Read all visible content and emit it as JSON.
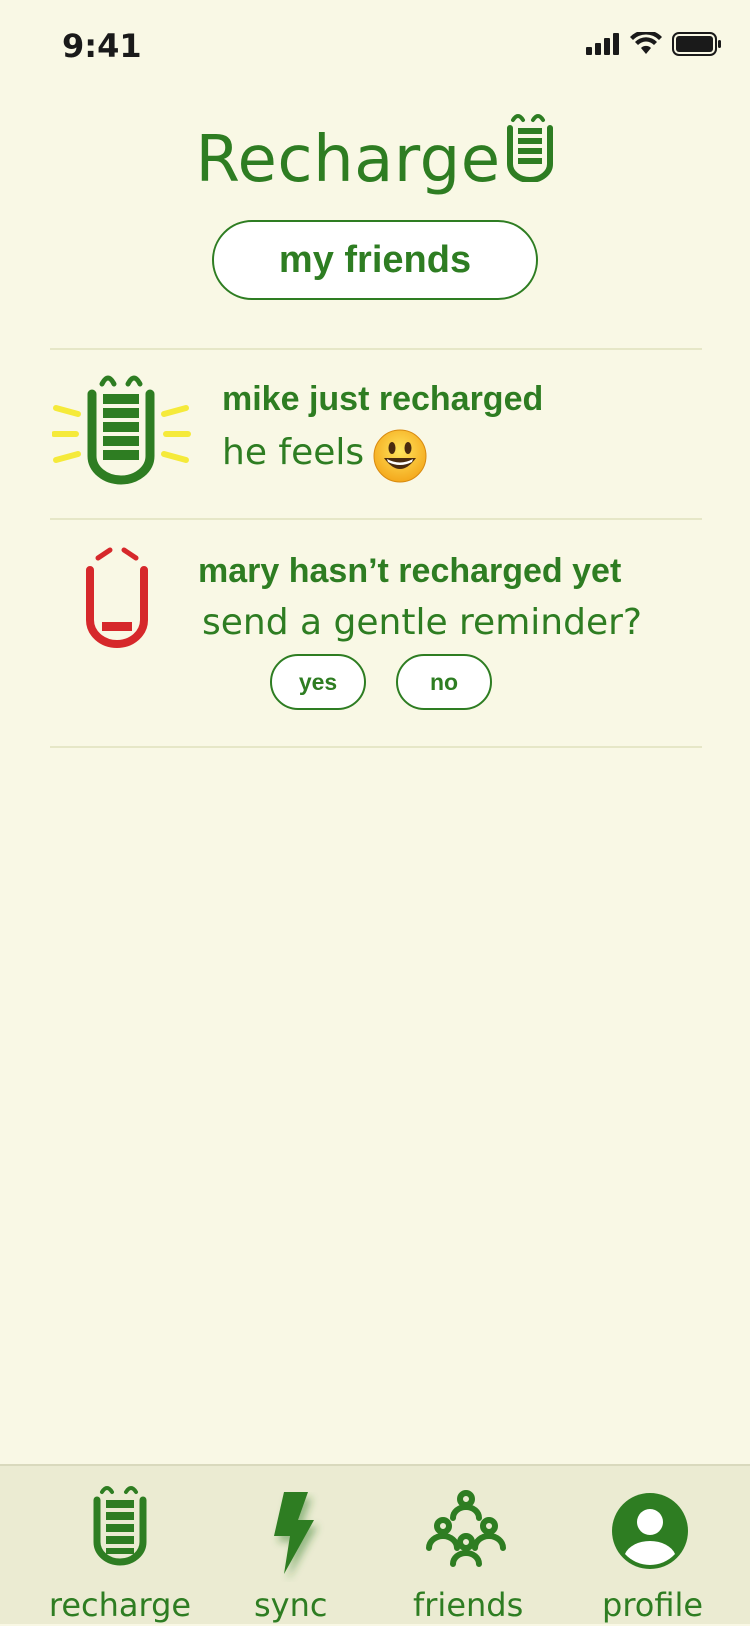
{
  "status_bar": {
    "time": "9:41",
    "icons": [
      "signal-icon",
      "wifi-icon",
      "battery-icon"
    ]
  },
  "header": {
    "title": "Recharge",
    "logo_icon": "battery-face-icon"
  },
  "friends_button": {
    "label": "my friends"
  },
  "feed": [
    {
      "title": "mike just recharged",
      "subtitle": "he feels",
      "mood": "😃",
      "status_icon": "charged-battery-icon",
      "status_color": "#2e7d22",
      "glow_color": "#f5ea3a"
    },
    {
      "title": "mary hasn’t recharged yet",
      "subtitle": "send a gentle reminder?",
      "status_icon": "empty-battery-icon",
      "status_color": "#d6282b",
      "actions": [
        {
          "label": "yes"
        },
        {
          "label": "no"
        }
      ]
    }
  ],
  "tab_bar": {
    "tabs": [
      {
        "label": "recharge",
        "icon": "battery-icon"
      },
      {
        "label": "sync",
        "icon": "lightning-icon"
      },
      {
        "label": "friends",
        "icon": "people-icon"
      },
      {
        "label": "profile",
        "icon": "user-icon"
      }
    ]
  },
  "colors": {
    "background": "#f9f8e5",
    "accent": "#2e7d22",
    "alert": "#d6282b",
    "glow": "#f5ea3a",
    "tab_bar": "#ebebd2"
  }
}
